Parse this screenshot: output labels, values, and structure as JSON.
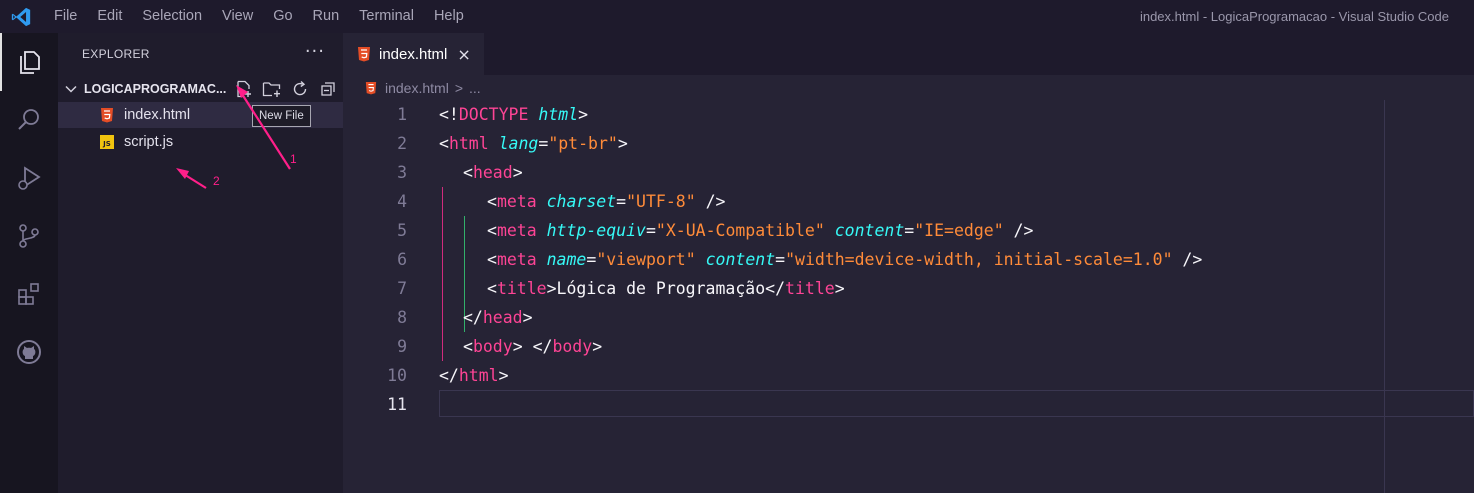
{
  "titlebar": {
    "menu": [
      "File",
      "Edit",
      "Selection",
      "View",
      "Go",
      "Run",
      "Terminal",
      "Help"
    ],
    "window_title": "index.html - LogicaProgramacao - Visual Studio Code"
  },
  "activitybar": {
    "icons": [
      "explorer-icon",
      "search-icon",
      "run-debug-icon",
      "source-control-icon",
      "extensions-icon",
      "github-icon"
    ]
  },
  "sidebar": {
    "title": "EXPLORER",
    "more": "···",
    "folder": "LOGICAPROGRAMAC...",
    "files": [
      {
        "name": "index.html",
        "icon": "html5-icon"
      },
      {
        "name": "script.js",
        "icon": "js-icon"
      }
    ],
    "tooltip": "New File",
    "annotations": [
      "1",
      "2"
    ]
  },
  "editor": {
    "tab": {
      "label": "index.html",
      "close": "×"
    },
    "breadcrumb": {
      "file": "index.html",
      "sep": ">",
      "rest": "..."
    },
    "line_numbers": [
      "1",
      "2",
      "3",
      "4",
      "5",
      "6",
      "7",
      "8",
      "9",
      "10",
      "11"
    ],
    "lines": {
      "l1": {
        "lt": "<!",
        "kw": "DOCTYPE",
        "attr": "html",
        "gt": ">"
      },
      "l2": {
        "lt": "<",
        "name": "html",
        "attr": "lang",
        "eq": "=",
        "val": "\"pt-br\"",
        "gt": ">"
      },
      "l3": {
        "lt": "<",
        "name": "head",
        "gt": ">"
      },
      "l4": {
        "lt": "<",
        "name": "meta",
        "attr": "charset",
        "eq": "=",
        "val": "\"UTF-8\"",
        "end": " />"
      },
      "l5": {
        "lt": "<",
        "name": "meta",
        "attr": "http-equiv",
        "eq": "=",
        "val": "\"X-UA-Compatible\"",
        "attr2": "content",
        "val2": "\"IE=edge\"",
        "end": " />"
      },
      "l6": {
        "lt": "<",
        "name": "meta",
        "attr": "name",
        "eq": "=",
        "val": "\"viewport\"",
        "attr2": "content",
        "val2": "\"width=device-width, initial-scale=1.0\"",
        "end": " />"
      },
      "l7": {
        "lt": "<",
        "name": "title",
        "gt": ">",
        "text": "Lógica de Programação",
        "close_lt": "</",
        "close_name": "title",
        "close_gt": ">"
      },
      "l8": {
        "lt": "</",
        "name": "head",
        "gt": ">"
      },
      "l9": {
        "lt": "<",
        "name": "body",
        "gt": ">",
        "close_lt": "</",
        "close_name": "body",
        "close_gt": ">"
      },
      "l10": {
        "lt": "</",
        "name": "html",
        "gt": ">"
      }
    }
  }
}
